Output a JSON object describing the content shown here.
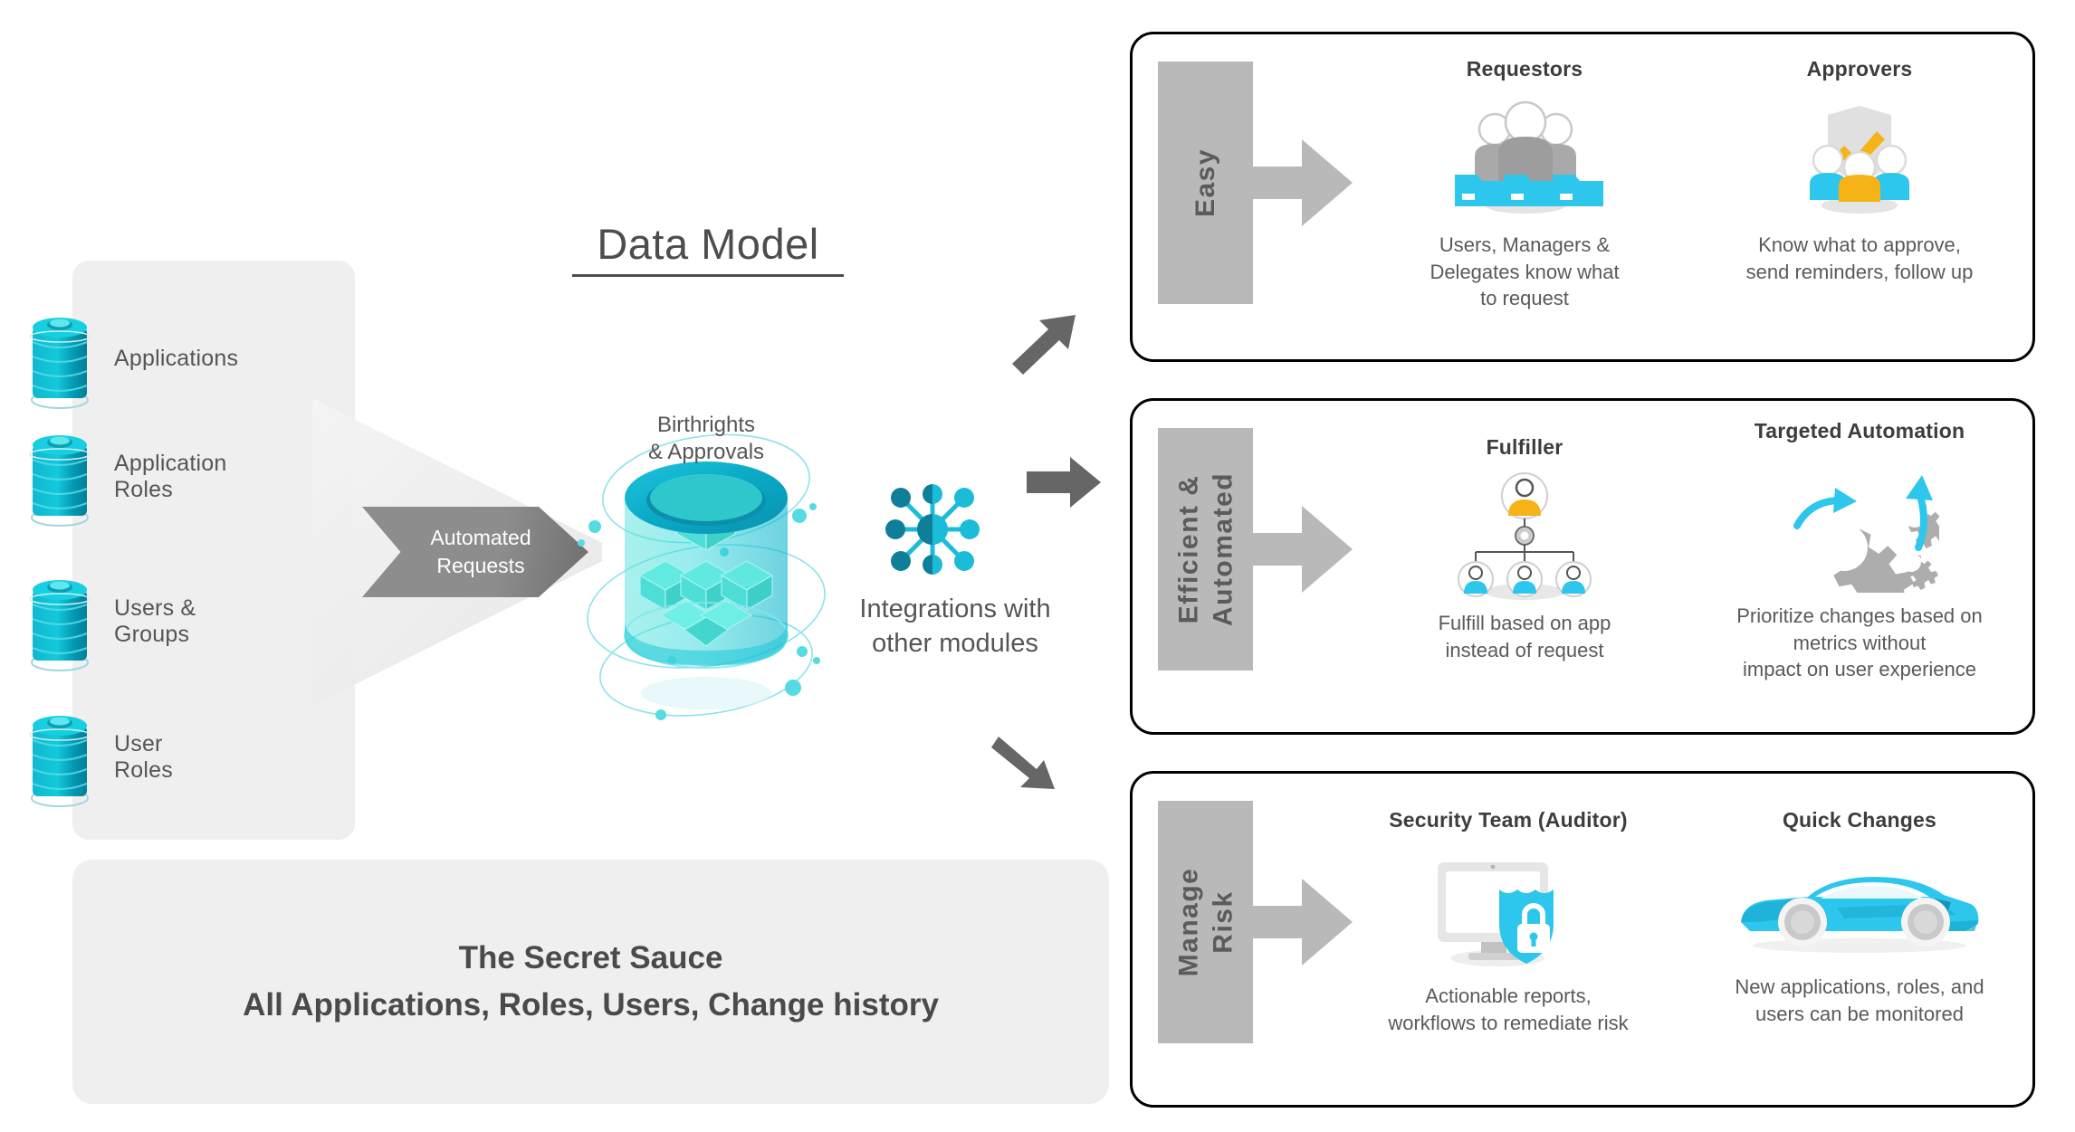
{
  "title": {
    "text": "Data Model"
  },
  "left_panel": {
    "items": [
      {
        "label": "Applications",
        "icon": "database-stack-icon"
      },
      {
        "label": "Application\nRoles",
        "icon": "database-stack-icon"
      },
      {
        "label": "Users &\nGroups",
        "icon": "database-stack-icon"
      },
      {
        "label": "User\nRoles",
        "icon": "database-stack-icon"
      }
    ]
  },
  "automated_requests": {
    "line1": "Automated",
    "line2": "Requests",
    "icon": "chevron-arrow-icon"
  },
  "central": {
    "db_icon": "data-cylinder-icon",
    "orbit_label": "Birthrights\n& Approvals"
  },
  "integrations": {
    "icon": "network-hub-icon",
    "label": "Integrations with\nother modules",
    "arrow_icon": "right-arrow-icon"
  },
  "connectors": {
    "up_arrow": "arrow-up-right-icon",
    "right_arrow": "arrow-right-icon",
    "down_arrow": "arrow-down-right-icon"
  },
  "secret_sauce": {
    "heading": "The Secret Sauce",
    "subheading": "All Applications, Roles, Users, Change history"
  },
  "cards": [
    {
      "band_label": "Easy",
      "band_arrow_icon": "block-right-arrow-icon",
      "columns": [
        {
          "title": "Requestors",
          "icon": "people-with-folders-icon",
          "desc": "Users, Managers &\nDelegates know what\nto request"
        },
        {
          "title": "Approvers",
          "icon": "shield-check-people-icon",
          "desc": "Know what to approve,\nsend reminders, follow up"
        }
      ]
    },
    {
      "band_label": "Efficient &\nAutomated",
      "band_arrow_icon": "block-right-arrow-icon",
      "columns": [
        {
          "title": "Fulfiller",
          "icon": "org-chart-people-icon",
          "desc": "Fulfill based on app\ninstead of request"
        },
        {
          "title": "Targeted Automation",
          "icon": "gears-icon",
          "desc": "Prioritize changes based on\nmetrics without\nimpact on user experience"
        }
      ]
    },
    {
      "band_label": "Manage\nRisk",
      "band_arrow_icon": "block-right-arrow-icon",
      "columns": [
        {
          "title": "Security Team (Auditor)",
          "icon": "monitor-shield-lock-icon",
          "desc": "Actionable reports,\nworkflows to remediate risk"
        },
        {
          "title": "Quick Changes",
          "icon": "sports-car-icon",
          "desc": "New applications, roles, and\nusers can be monitored"
        }
      ]
    }
  ],
  "colors": {
    "cyan": "#29c3e8",
    "teal": "#00a5bf",
    "orange": "#f5b317",
    "gray": "#b9b9b9",
    "panel_gray": "#efefef",
    "text": "#5a5a5a"
  }
}
